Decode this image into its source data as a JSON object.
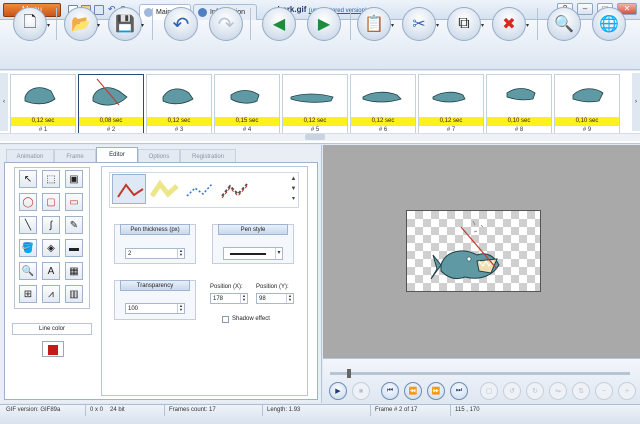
{
  "titlebar": {
    "menu_label": "Menu",
    "tabs": [
      {
        "label": "Main"
      },
      {
        "label": "Information"
      }
    ],
    "title": "shark.gif",
    "unregistered": "(unregistered version)",
    "window_buttons": {
      "help": "?",
      "minimize": "–",
      "maximize": "□",
      "close": "✕"
    }
  },
  "toolbar": {
    "buttons": [
      {
        "name": "new-icon",
        "glyph": "🗋"
      },
      {
        "name": "open-folder-icon",
        "glyph": "📂"
      },
      {
        "name": "save-icon",
        "glyph": "💾"
      },
      {
        "name": "undo-icon",
        "glyph": "↶"
      },
      {
        "name": "redo-icon",
        "glyph": "↷"
      },
      {
        "name": "previous-frame-icon",
        "glyph": "◀"
      },
      {
        "name": "next-frame-icon",
        "glyph": "▶"
      },
      {
        "name": "paste-icon",
        "glyph": "📋"
      },
      {
        "name": "cut-icon",
        "glyph": "✂"
      },
      {
        "name": "copy-icon",
        "glyph": "⧉"
      },
      {
        "name": "delete-icon",
        "glyph": "✖"
      },
      {
        "name": "zoom-icon",
        "glyph": "🔍"
      },
      {
        "name": "web-icon",
        "glyph": "🌐"
      }
    ]
  },
  "frames": [
    {
      "duration": "0,12 sec",
      "label": "# 1"
    },
    {
      "duration": "0,08 sec",
      "label": "# 2"
    },
    {
      "duration": "0,12 sec",
      "label": "# 3"
    },
    {
      "duration": "0,15 sec",
      "label": "# 4"
    },
    {
      "duration": "0,12 sec",
      "label": "# 5"
    },
    {
      "duration": "0,12 sec",
      "label": "# 6"
    },
    {
      "duration": "0,12 sec",
      "label": "# 7"
    },
    {
      "duration": "0,10 sec",
      "label": "# 8"
    },
    {
      "duration": "0,10 sec",
      "label": "# 9"
    }
  ],
  "panel_tabs": [
    "Animation",
    "Frame",
    "Editor",
    "Options",
    "Registration"
  ],
  "tools": [
    "↖",
    "⬚",
    "▣",
    "◯",
    "▢",
    "▭",
    "╲",
    "∫",
    "✎",
    "🪣",
    "◈",
    "▬",
    "🔍",
    "A",
    "▦",
    "⊞",
    "⩘",
    "▥"
  ],
  "line_color": {
    "label": "Line color",
    "value": "#c51a1a"
  },
  "editor": {
    "pen_thickness": {
      "label": "Pen thickness (px)",
      "value": "2"
    },
    "pen_style": {
      "label": "Pen style"
    },
    "transparency": {
      "label": "Transparency",
      "value": "100"
    },
    "position_x": {
      "label": "Position (X):",
      "value": "178"
    },
    "position_y": {
      "label": "Position (Y):",
      "value": "98"
    },
    "shadow_effect": {
      "label": "Shadow effect"
    }
  },
  "status": {
    "gif_version": "GIF version: GIF89a",
    "dimensions": "0 x 0",
    "bits": "24 bit",
    "frames_count": "Frames count: 17",
    "length": "Length: 1.93",
    "frame_position": "Frame # 2 of 17",
    "cursor": "115 , 170"
  }
}
